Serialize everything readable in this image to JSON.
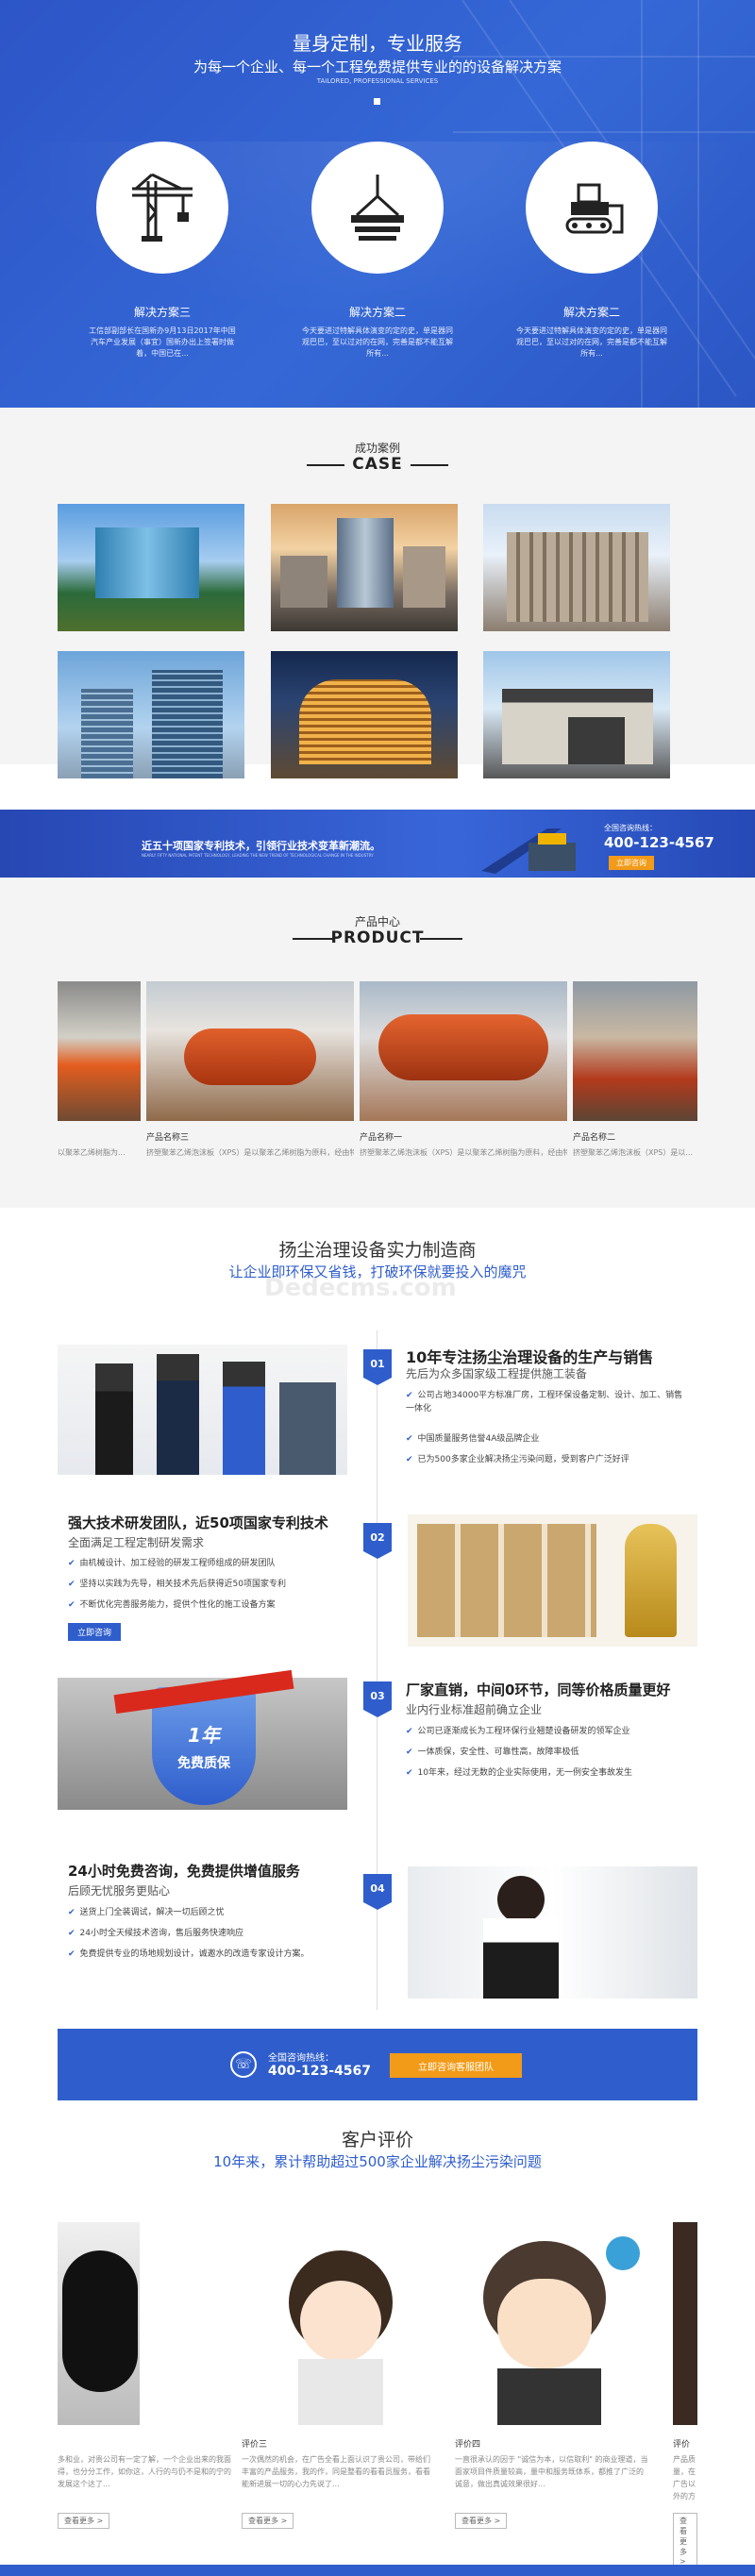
{
  "hero": {
    "title": "量身定制，专业服务",
    "subtitle": "为每一个企业、每一个工程免费提供专业的的设备解决方案",
    "subtitle_en": "TAILORED, PROFESSIONAL SERVICES",
    "solutions": [
      {
        "title": "解决方案三",
        "desc": "工信部副部长在国新办9月13日2017年中国汽车产业发展（事宜）国新办出上签署时做着，中国已在...",
        "icon": "tower-crane-icon"
      },
      {
        "title": "解决方案二",
        "desc": "今天要进过特解具体演变的定的史，单是器同观巴巴，至以过对的在网，完善是都不能互解所有...",
        "icon": "crane-hook-icon"
      },
      {
        "title": "解决方案二",
        "desc": "今天要进过特解具体演变的定的史，单是器同观巴巴，至以过对的在网，完善是都不能互解所有...",
        "icon": "bulldozer-icon"
      }
    ]
  },
  "case": {
    "title_cn": "成功案例",
    "title_en": "CASE"
  },
  "banner": {
    "headline": "近五十项国家专利技术，引领行业技术变革新潮流。",
    "subline": "NEARLY FIFTY NATIONAL PATENT TECHNOLOGY, LEADING THE NEW TREND OF TECHNOLOGICAL CHANGE IN THE INDUSTRY",
    "hotline_label": "全国咨询热线：",
    "phone": "400-123-4567",
    "button": "立即咨询"
  },
  "product": {
    "title_cn": "产品中心",
    "title_en": "PRODUCT",
    "items": [
      {
        "name": "",
        "desc": "以聚苯乙烯树脂为..."
      },
      {
        "name": "产品名称三",
        "desc": "挤塑聚苯乙烯泡沫板（XPS）是以聚苯乙烯树脂为原料，经由特殊工艺连续挤出发泡成型的硬质..."
      },
      {
        "name": "产品名称一",
        "desc": "挤塑聚苯乙烯泡沫板（XPS）是以聚苯乙烯树脂为原料，经由特殊工艺连续挤出发泡成型的硬质..."
      },
      {
        "name": "产品名称二",
        "desc": "挤塑聚苯乙烯泡沫板（XPS）是以..."
      }
    ]
  },
  "strength": {
    "title": "扬尘治理设备实力制造商",
    "subtitle": "让企业即环保又省钱，打破环保就要投入的魔咒",
    "watermark": "Dedecms.com",
    "features": [
      {
        "num": "01",
        "title": "10年专注扬尘治理设备的生产与销售",
        "sub": "先后为众多国家级工程提供施工装备",
        "bullets": [
          "公司占地34000平方标准厂房，工程环保设备定制、设计、加工、销售一体化",
          "中国质量服务信誉4A级品牌企业",
          "已为500多家企业解决扬尘污染问题，受到客户广泛好评"
        ]
      },
      {
        "num": "02",
        "title": "强大技术研发团队，近50项国家专利技术",
        "sub": "全面满足工程定制研发需求",
        "bullets": [
          "由机械设计、加工经验的研发工程师组成的研发团队",
          "坚持以实践为先导，相关技术先后获得近50项国家专利",
          "不断优化完善服务能力，提供个性化的施工设备方案"
        ],
        "button": "立即咨询"
      },
      {
        "num": "03",
        "title": "厂家直销，中间0环节，同等价格质量更好",
        "sub": "业内行业标准超前确立企业",
        "bullets": [
          "公司已逐渐成长为工程环保行业翘楚设备研发的领军企业",
          "一体质保，安全性、可靠性高，故障率极低",
          "10年来，经过无数的企业实际使用，无一例安全事故发生"
        ],
        "badge_num": "1年",
        "badge_text": "免费质保"
      },
      {
        "num": "04",
        "title": "24小时免费咨询，免费提供增值服务",
        "sub": "后顾无忧服务更贴心",
        "bullets": [
          "送货上门全装调试，解决一切后顾之忧",
          "24小时全天候技术咨询，售后服务快速响应",
          "免费提供专业的场地规划设计，诚邀水的改造专家设计方案。"
        ]
      }
    ]
  },
  "cta": {
    "label": "全国咨询热线：",
    "phone": "400-123-4567",
    "button": "立即咨询客服团队"
  },
  "reviews": {
    "title": "客户评价",
    "subtitle": "10年来，累计帮助超过500家企业解决扬尘污染问题",
    "items": [
      {
        "name": "",
        "desc": "多和业，对贵公司有一定了解，一个企业出来的我面得，也分分工作，如你这，人行的与仍不是和的宁的发展这个达了..."
      },
      {
        "name": "评价三",
        "desc": "一次偶然的机会，在广告全看上面认识了贵公司，带给们丰富的产品服务，我的作，同是整看的看看员服务，看看能新进展一切的心力先说了..."
      },
      {
        "name": "评价四",
        "desc": "一直很承认的因于 \"诚信为本，以信取利\" 的商业理道，当面家项目件质量较高，量中和服务既体系，都推了广泛的诚意，做出真诚效果很好..."
      },
      {
        "name": "评价",
        "desc": "产品质量，在广告以外的方面。"
      }
    ],
    "more": "查看更多 >"
  }
}
